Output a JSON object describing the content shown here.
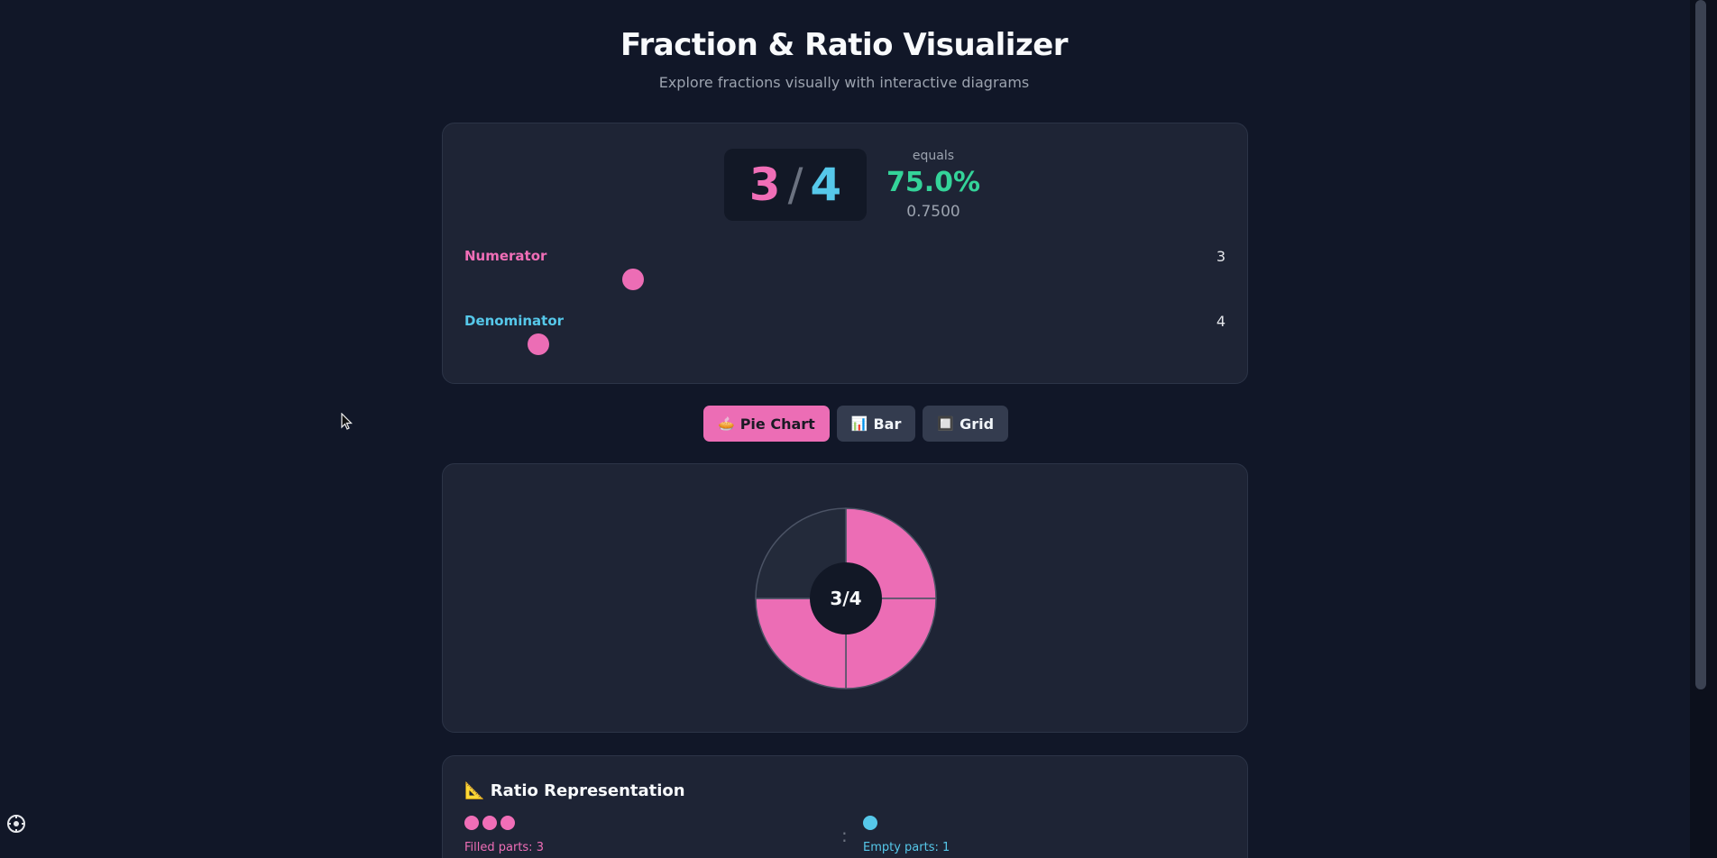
{
  "header": {
    "title": "Fraction & Ratio Visualizer",
    "subtitle": "Explore fractions visually with interactive diagrams"
  },
  "fraction": {
    "numerator": "3",
    "slash": "/",
    "denominator": "4",
    "equals_label": "equals",
    "percent": "75.0%",
    "decimal": "0.7500"
  },
  "sliders": {
    "numerator": {
      "label": "Numerator",
      "value": "3",
      "min": 0,
      "max": 4
    },
    "denominator": {
      "label": "Denominator",
      "value": "4",
      "min": 1,
      "max": 12
    }
  },
  "tabs": [
    {
      "icon": "🥧",
      "label": "Pie Chart",
      "active": true
    },
    {
      "icon": "📊",
      "label": "Bar",
      "active": false
    },
    {
      "icon": "🔲",
      "label": "Grid",
      "active": false
    }
  ],
  "chart_data": {
    "type": "pie",
    "total_parts": 4,
    "filled_parts": 3,
    "center_label": "3/4",
    "colors": {
      "filled": "#ec6db5",
      "empty": "#232a3a",
      "center": "#121826"
    }
  },
  "ratio": {
    "icon": "📐",
    "title": "Ratio Representation",
    "filled_label": "Filled parts: 3",
    "empty_label": "Empty parts: 1",
    "separator": ":",
    "filled_count": 3,
    "empty_count": 1
  },
  "colors": {
    "background": "#111728",
    "card": "#1e2435",
    "numerator": "#f06eb7",
    "denominator": "#56c8ea",
    "percent": "#34d399"
  }
}
